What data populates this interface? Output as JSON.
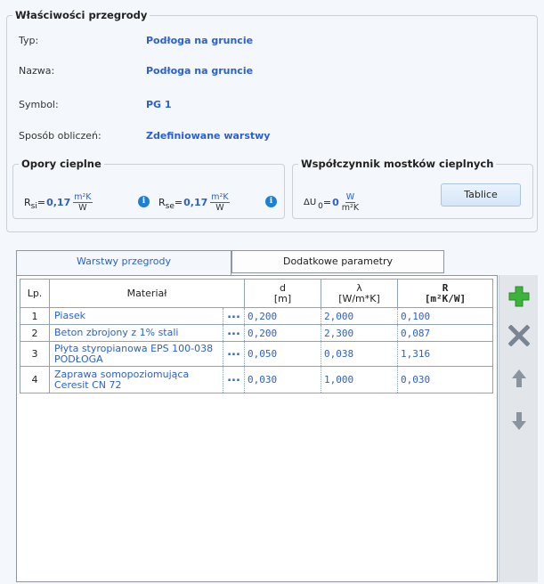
{
  "properties": {
    "title": "Właściwości przegrody",
    "rows": [
      {
        "label": "Typ:",
        "value": "Podłoga na gruncie"
      },
      {
        "label": "Nazwa:",
        "value": "Podłoga na gruncie"
      },
      {
        "label": "Symbol:",
        "value": "PG 1"
      },
      {
        "label": "Sposób obliczeń:",
        "value": "Zdefiniowane warstwy"
      }
    ]
  },
  "thermal": {
    "title": "Opory cieplne",
    "rsi": {
      "r": "R",
      "sub": "si",
      "eq": "=",
      "value": "0,17",
      "unit_num": "m²K",
      "unit_den": "W"
    },
    "rse": {
      "r": "R",
      "sub": "se",
      "eq": "=",
      "value": "0,17",
      "unit_num": "m²K",
      "unit_den": "W"
    },
    "info_glyph": "i"
  },
  "bridges": {
    "title": "Współczynnik mostków cieplnych",
    "symbol": "ΔU",
    "sub": "0",
    "eq": "=",
    "value": "0",
    "unit_num": "W",
    "unit_den": "m²K",
    "button": "Tablice"
  },
  "tabs": [
    {
      "label": "Warstwy przegrody",
      "active": true
    },
    {
      "label": "Dodatkowe parametry",
      "active": false
    }
  ],
  "table": {
    "headers": {
      "lp": "Lp.",
      "material": "Materiał",
      "d_sym": "d",
      "d_unit": "[m]",
      "l_sym": "λ",
      "l_unit": "[W/m*K]",
      "r_sym": "R",
      "r_unit": "[m²K/W]"
    },
    "dots": "...",
    "rows": [
      {
        "lp": "1",
        "material": "Piasek",
        "d": "0,200",
        "lambda": "2,000",
        "r": "0,100"
      },
      {
        "lp": "2",
        "material": "Beton zbrojony z 1% stali",
        "d": "0,200",
        "lambda": "2,300",
        "r": "0,087"
      },
      {
        "lp": "3",
        "material": "Płyta styropianowa EPS 100-038 PODŁOGA",
        "d": "0,050",
        "lambda": "0,038",
        "r": "1,316"
      },
      {
        "lp": "4",
        "material": "Zaprawa somopoziomująca Ceresit CN 72",
        "d": "0,030",
        "lambda": "1,000",
        "r": "0,030"
      }
    ]
  },
  "side_buttons": [
    {
      "name": "add-icon",
      "color": "#3cb43c"
    },
    {
      "name": "delete-icon",
      "color": "#7a8593"
    },
    {
      "name": "arrow-up-icon",
      "color": "#8a949f"
    },
    {
      "name": "arrow-down-icon",
      "color": "#8a949f"
    }
  ]
}
